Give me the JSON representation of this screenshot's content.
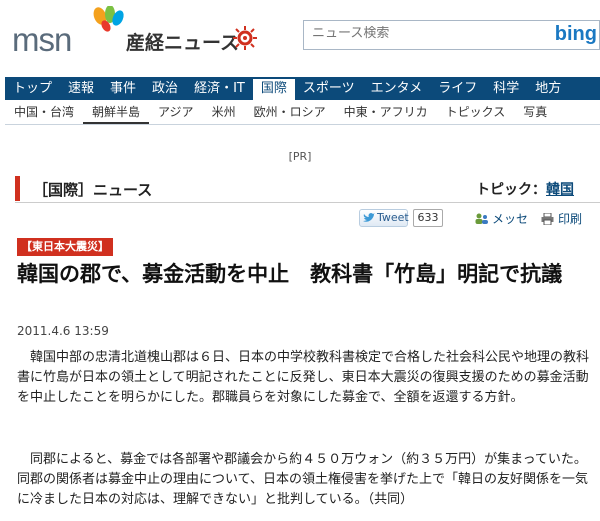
{
  "header": {
    "msn_logo_text": "msn",
    "sankei_title": "産経ニュース",
    "search_placeholder": "ニュース検索",
    "bing_label": "bing"
  },
  "nav": {
    "items": [
      "トップ",
      "速報",
      "事件",
      "政治",
      "経済・IT",
      "国際",
      "スポーツ",
      "エンタメ",
      "ライフ",
      "科学",
      "地方"
    ],
    "active": "国際"
  },
  "subnav": {
    "items": [
      "中国・台湾",
      "朝鮮半島",
      "アジア",
      "米州",
      "欧州・ロシア",
      "中東・アフリカ",
      "トピックス",
      "写真"
    ],
    "active": "朝鮮半島"
  },
  "pr_label": "[PR]",
  "section": {
    "title": "［国際］ニュース",
    "topic_prefix": "トピック：",
    "topic_link": "韓国"
  },
  "social": {
    "tweet_label": "Tweet",
    "tweet_count": "633",
    "mixi_label": "メッセ",
    "print_label": "印刷"
  },
  "article": {
    "category": "【東日本大震災】",
    "headline": "韓国の郡で、募金活動を中止　教科書「竹島」明記で抗議",
    "date": "2011.4.6 13:59",
    "paragraph1": "韓国中部の忠清北道槐山郡は６日、日本の中学校教科書検定で合格した社会科公民や地理の教科書に竹島が日本の領土として明記されたことに反発し、東日本大震災の復興支援のための募金活動を中止したことを明らかにした。郡職員らを対象にした募金で、全額を返還する方針。",
    "paragraph2": "同郡によると、募金では各部署や郡議会から約４５０万ウォン（約３５万円）が集まっていた。同郡の関係者は募金中止の理由について、日本の領土権侵害を挙げた上で「韓日の友好関係を一気に冷ました日本の対応は、理解できない」と批判している。（共同）"
  },
  "colors": {
    "nav_bg": "#0c4a7a",
    "accent_red": "#d0301f",
    "bing_blue": "#1a78c2"
  }
}
